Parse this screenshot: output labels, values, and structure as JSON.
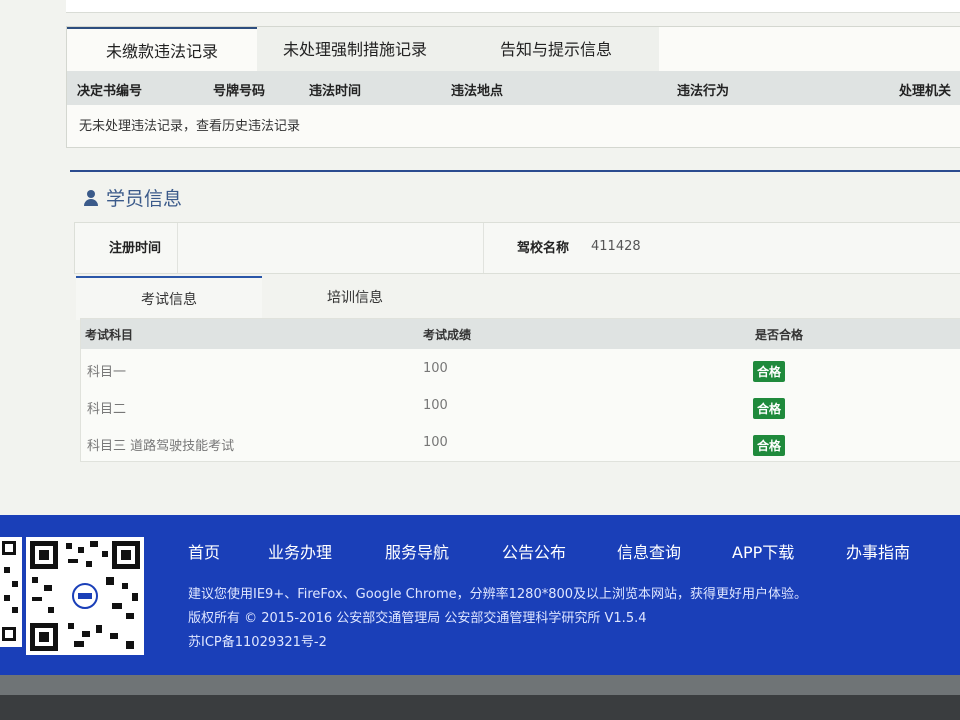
{
  "violation_tabs": {
    "tab1": "未缴款违法记录",
    "tab2": "未处理强制措施记录",
    "tab3": "告知与提示信息"
  },
  "violation_table": {
    "headers": [
      "决定书编号",
      "号牌号码",
      "违法时间",
      "违法地点",
      "违法行为",
      "处理机关"
    ],
    "empty_message": "无未处理违法记录，查看历史违法记录"
  },
  "student": {
    "title": "学员信息",
    "reg_time_label": "注册时间",
    "reg_time_value": "",
    "school_label": "驾校名称",
    "school_value": "411428"
  },
  "exam_tabs": {
    "tab1": "考试信息",
    "tab2": "培训信息"
  },
  "exam_table": {
    "headers": [
      "考试科目",
      "考试成绩",
      "是否合格"
    ],
    "rows": [
      {
        "subject": "科目一",
        "score": "100",
        "pass": "合格"
      },
      {
        "subject": "科目二",
        "score": "100",
        "pass": "合格"
      },
      {
        "subject": "科目三 道路驾驶技能考试",
        "score": "100",
        "pass": "合格"
      }
    ]
  },
  "footer": {
    "nav": [
      "首页",
      "业务办理",
      "服务导航",
      "公告公布",
      "信息查询",
      "APP下载",
      "办事指南"
    ],
    "line1": "建议您使用IE9+、FireFox、Google Chrome，分辨率1280*800及以上浏览本网站，获得更好用户体验。",
    "line2": "版权所有 © 2015-2016 公安部交通管理局 公安部交通管理科学研究所 V1.5.4",
    "line3": "苏ICP备11029321号-2"
  },
  "colors": {
    "footer_bg": "#1a3fb8",
    "pass_badge": "#1f8a3c",
    "accent": "#2b4b8f"
  }
}
